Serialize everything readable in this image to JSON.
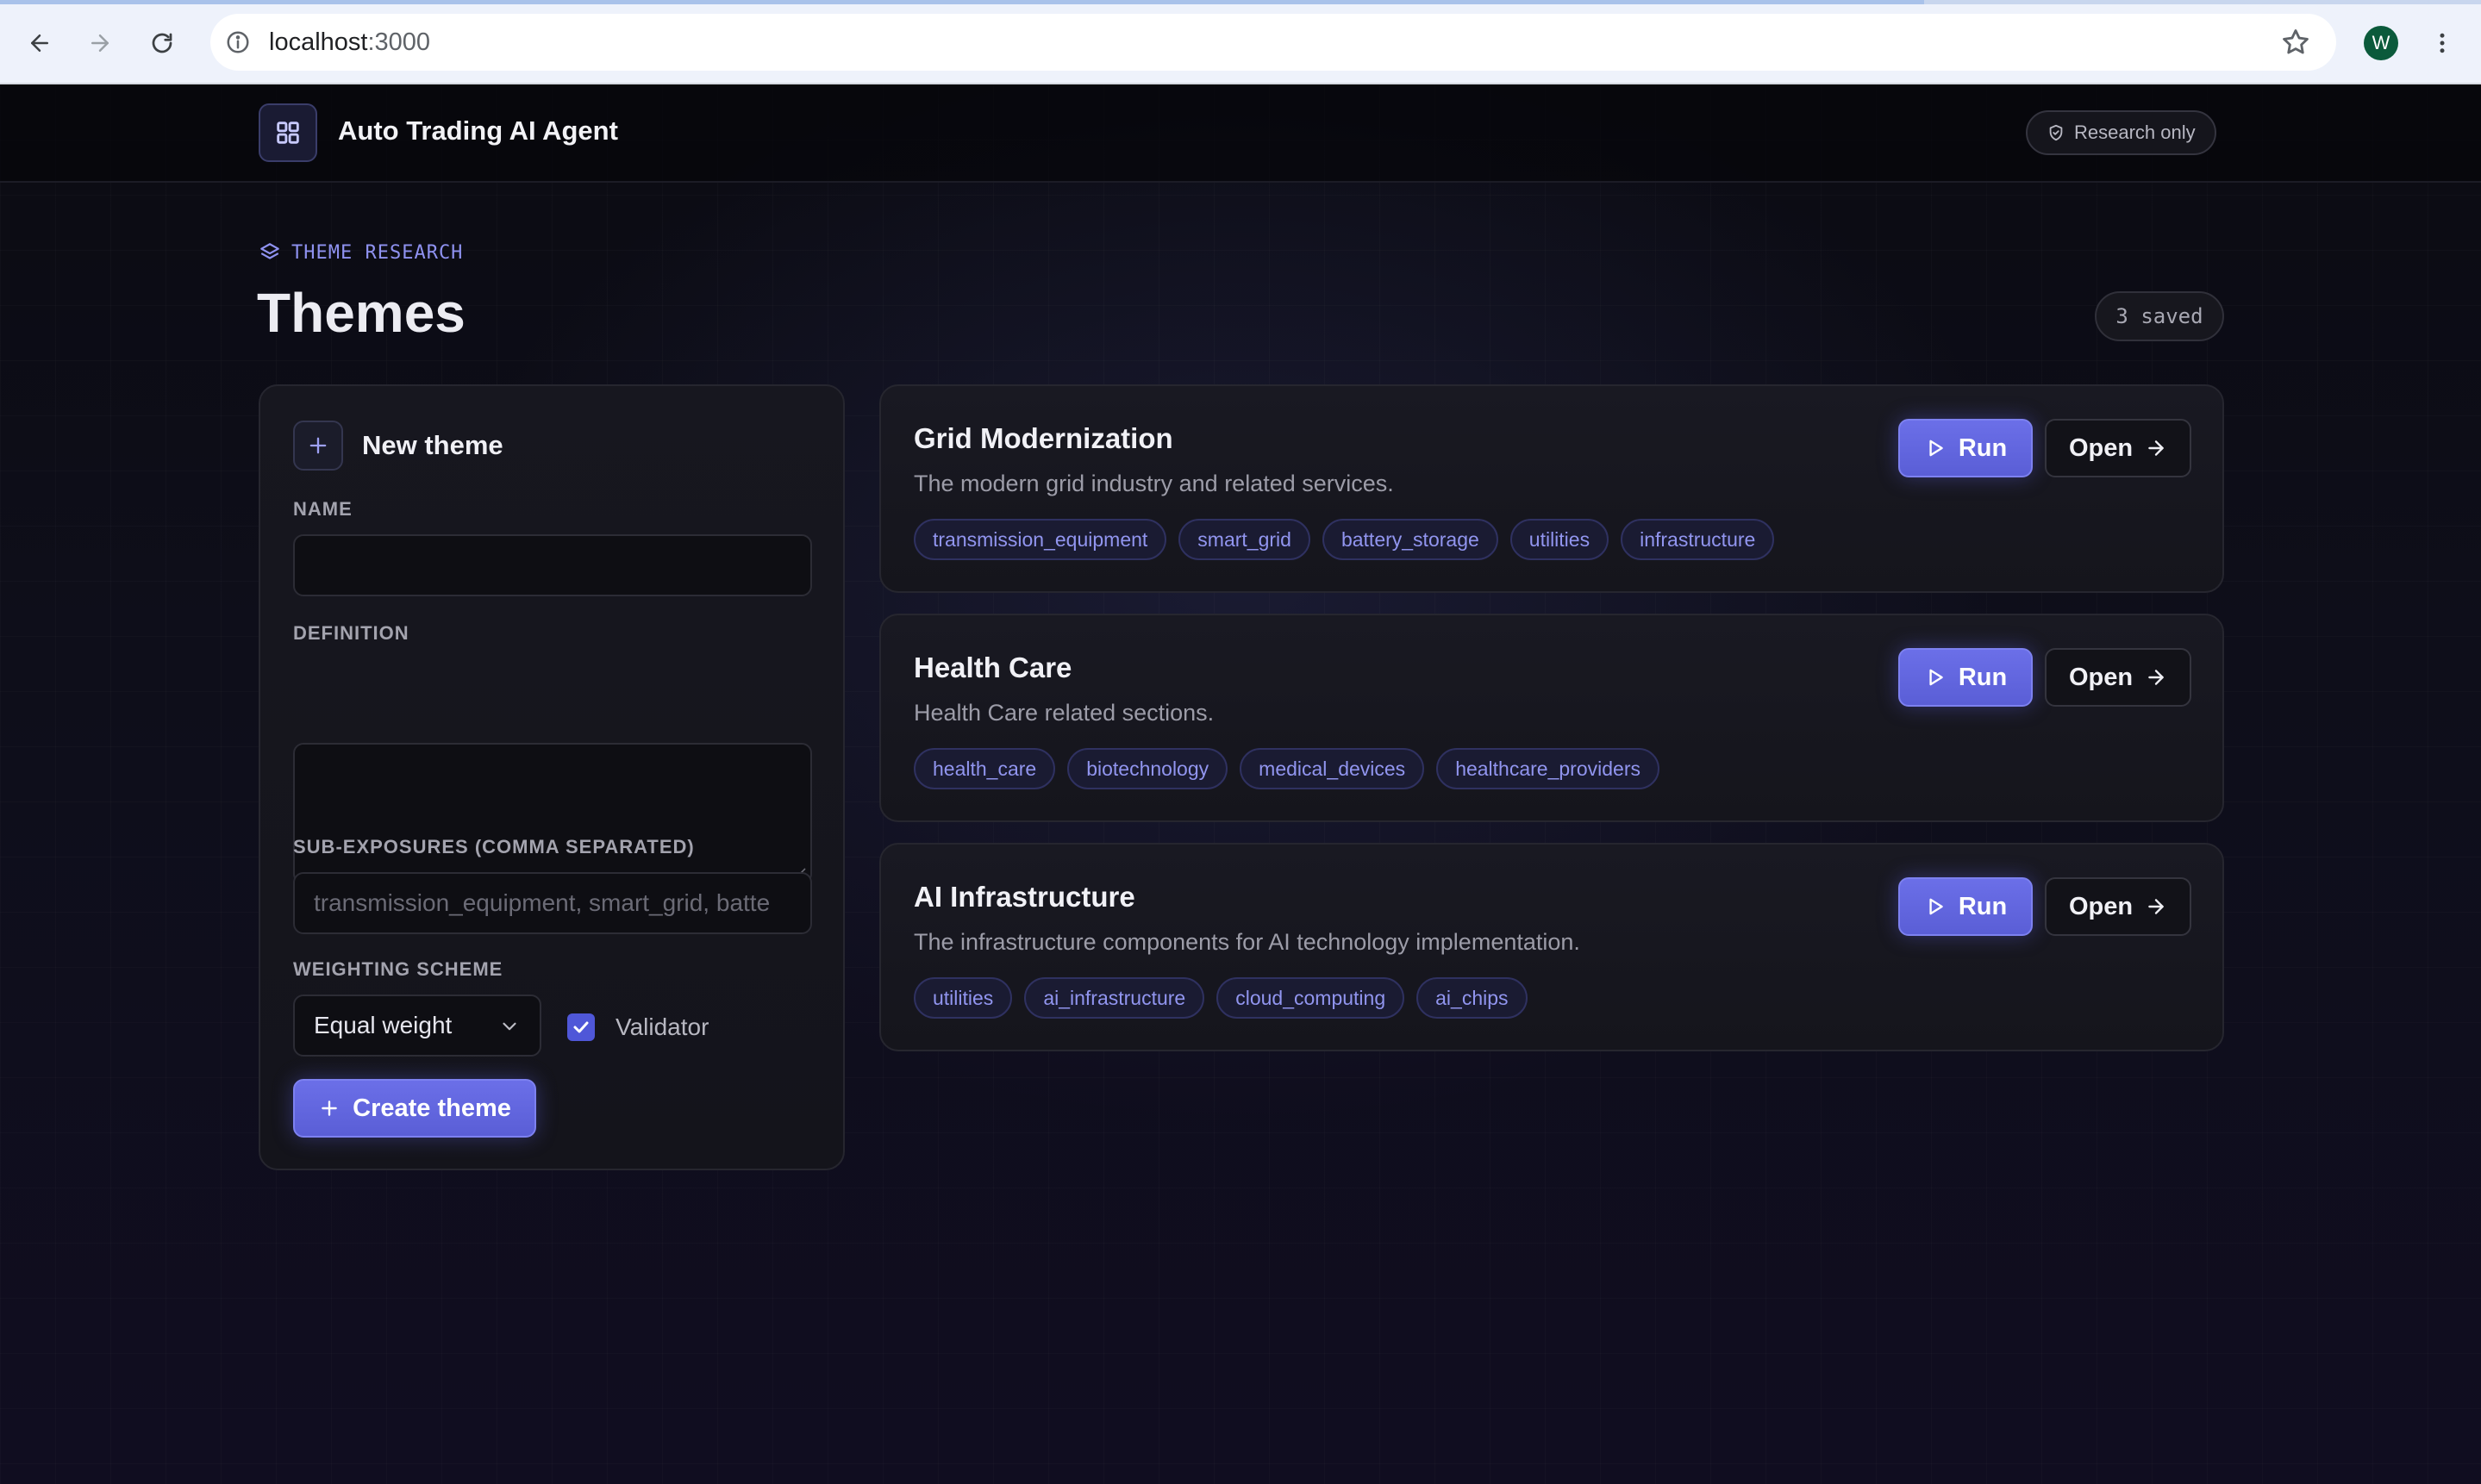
{
  "browser": {
    "url_host": "localhost",
    "url_port": ":3000",
    "profile_initial": "W"
  },
  "header": {
    "app_title": "Auto Trading AI Agent",
    "badge_label": "Research only"
  },
  "page": {
    "eyebrow": "THEME RESEARCH",
    "title": "Themes",
    "saved_count": "3 saved"
  },
  "form": {
    "title": "New theme",
    "name_label": "NAME",
    "name_value": "",
    "definition_label": "DEFINITION",
    "subexposures_label": "SUB-EXPOSURES (COMMA SEPARATED)",
    "subexposures_placeholder": "transmission_equipment, smart_grid, batte",
    "weighting_label": "WEIGHTING SCHEME",
    "weighting_selected": "Equal weight",
    "validator_label": "Validator",
    "validator_checked": true,
    "create_label": "Create theme"
  },
  "themes": [
    {
      "name": "Grid Modernization",
      "description": "The modern grid industry and related services.",
      "tags": [
        "transmission_equipment",
        "smart_grid",
        "battery_storage",
        "utilities",
        "infrastructure"
      ],
      "run_label": "Run",
      "open_label": "Open"
    },
    {
      "name": "Health Care",
      "description": "Health Care related sections.",
      "tags": [
        "health_care",
        "biotechnology",
        "medical_devices",
        "healthcare_providers"
      ],
      "run_label": "Run",
      "open_label": "Open"
    },
    {
      "name": "AI Infrastructure",
      "description": "The infrastructure components for AI technology implementation.",
      "tags": [
        "utilities",
        "ai_infrastructure",
        "cloud_computing",
        "ai_chips"
      ],
      "run_label": "Run",
      "open_label": "Open"
    }
  ],
  "colors": {
    "accent": "#6366f1",
    "background": "#0a0a10",
    "tag_text": "#9195ef"
  }
}
